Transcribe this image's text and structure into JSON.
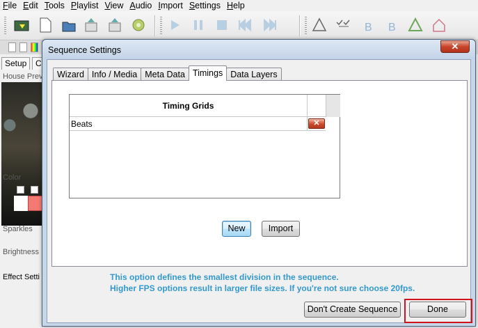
{
  "menubar": [
    {
      "underline": "F",
      "rest": "ile"
    },
    {
      "underline": "E",
      "rest": "dit"
    },
    {
      "underline": "T",
      "rest": "ools"
    },
    {
      "underline": "P",
      "rest": "laylist"
    },
    {
      "underline": "V",
      "rest": "iew"
    },
    {
      "underline": "A",
      "rest": "udio"
    },
    {
      "underline": "I",
      "rest": "mport"
    },
    {
      "underline": "S",
      "rest": "ettings"
    },
    {
      "underline": "H",
      "rest": "elp"
    }
  ],
  "left_panel": {
    "tab_setup": "Setup",
    "tab_partial": "C",
    "house_preview": "House Prev",
    "color": "Color",
    "sparkles": "Sparkles",
    "brightness": "Brightness",
    "effect_settings": "Effect Setti"
  },
  "dialog": {
    "title": "Sequence Settings",
    "close_glyph": "✕",
    "tabs": [
      "Wizard",
      "Info / Media",
      "Meta Data",
      "Timings",
      "Data Layers"
    ],
    "active_tab": "Timings",
    "grid": {
      "header": "Timing Grids",
      "rows": [
        {
          "name": "Beats"
        }
      ]
    },
    "new_button": "New",
    "import_button": "Import",
    "info_line1": "This option defines the smallest division in the sequence.",
    "info_line2": "Higher FPS options result in larger file sizes.  If you're not sure choose 20fps.",
    "dont_create_button": "Don't Create Sequence",
    "done_button": "Done"
  },
  "colors": {
    "accent_info": "#3399cc",
    "highlight_box": "#d0131c",
    "close_red": "#c7462b"
  }
}
